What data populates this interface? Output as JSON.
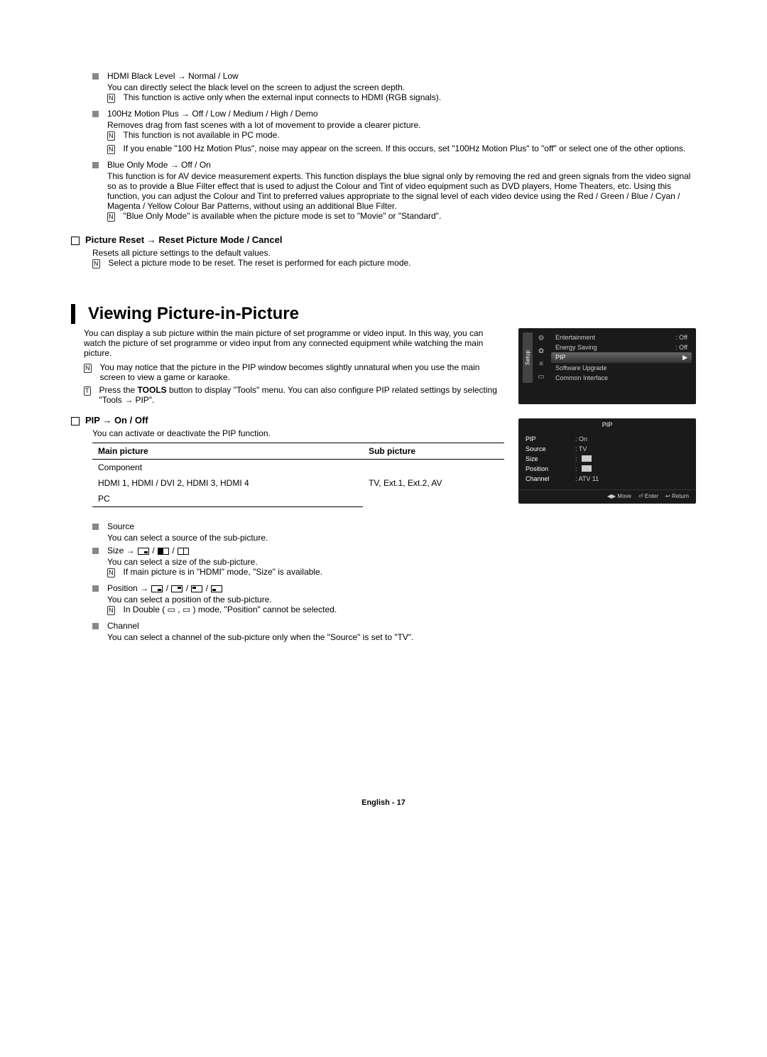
{
  "hdmi": {
    "title": "HDMI Black Level → Normal / Low",
    "desc": "You can directly select the black level on the screen to adjust the screen depth.",
    "note": "This function is active only when the external input connects to HDMI (RGB signals)."
  },
  "motion": {
    "title": "100Hz Motion Plus → Off / Low / Medium / High / Demo",
    "desc": "Removes drag from fast scenes with a lot of movement to provide a clearer picture.",
    "note1": "This function is not available in PC mode.",
    "note2": "If you enable \"100 Hz Motion Plus\", noise may appear on the screen. If this occurs, set \"100Hz Motion Plus\" to \"off\" or select one of the other options."
  },
  "blue": {
    "title": "Blue Only Mode → Off / On",
    "desc": "This function is for AV device measurement experts. This function displays the blue signal only by removing the red and green signals from the video signal so as to provide a Blue Filter effect that is used to adjust the Colour and Tint of video equipment such as DVD players, Home Theaters, etc. Using this function, you can adjust the Colour and Tint to preferred values appropriate to the signal level of each video device using the Red / Green / Blue / Cyan / Magenta / Yellow Colour Bar Patterns, without using an additional Blue Filter.",
    "note": "\"Blue Only Mode\" is available when the picture mode is set to \"Movie\" or \"Standard\"."
  },
  "reset": {
    "heading": "Picture Reset → Reset Picture Mode / Cancel",
    "desc": "Resets all picture settings to the default values.",
    "note": "Select a picture mode to be reset. The reset is performed for each picture mode."
  },
  "pip": {
    "heading": "Viewing Picture-in-Picture",
    "intro": "You can display a sub picture within the main picture of set programme or video input. In this way, you can watch the picture of set programme or video input from any connected equipment while watching the main picture.",
    "note_unnatural": "You may notice that the picture in the PIP window becomes slightly unnatural when you use the main screen to view a game or karaoke.",
    "tools_prefix": "Press the ",
    "tools_bold": "TOOLS",
    "tools_suffix": " button to display \"Tools\" menu. You can also configure PIP related settings by selecting \"Tools → PIP\".",
    "onoff_heading": "PIP → On / Off",
    "onoff_desc": "You can activate or deactivate the PIP function.",
    "table": {
      "h1": "Main picture",
      "h2": "Sub picture",
      "r1": "Component",
      "r2": "HDMI 1, HDMI / DVI 2, HDMI 3, HDMI 4",
      "r3": "PC",
      "sub": "TV, Ext.1, Ext.2, AV"
    },
    "source": {
      "title": "Source",
      "desc": "You can select a source of the sub-picture."
    },
    "size": {
      "title": "Size → ",
      "desc": "You can select a size of the sub-picture.",
      "note": "If main picture is in \"HDMI\" mode, \"Size\" is available."
    },
    "position": {
      "title": "Position → ",
      "desc": "You can select a position of the sub-picture.",
      "note": "In Double ( ▭ , ▭ ) mode, \"Position\" cannot be selected."
    },
    "channel": {
      "title": "Channel",
      "desc": "You can select a channel of the sub-picture only when the \"Source\" is set to \"TV\"."
    }
  },
  "osd1": {
    "tab": "Setup",
    "rows": [
      {
        "k": "Entertainment",
        "v": ": Off"
      },
      {
        "k": "Energy Saving",
        "v": ": Off"
      },
      {
        "k": "PIP",
        "v": ""
      },
      {
        "k": "Software Upgrade",
        "v": ""
      },
      {
        "k": "Common Interface",
        "v": ""
      }
    ]
  },
  "osd2": {
    "title": "PIP",
    "rows": {
      "pip": {
        "k": "PIP",
        "v": ": On"
      },
      "source": {
        "k": "Source",
        "v": ": TV"
      },
      "size": {
        "k": "Size",
        "v": ": "
      },
      "position": {
        "k": "Position",
        "v": ": "
      },
      "channel": {
        "k": "Channel",
        "v": ": ATV 11"
      }
    },
    "foot": {
      "move": "Move",
      "enter": "Enter",
      "return": "Return"
    }
  },
  "footer": "English - 17",
  "glyphs": {
    "note": "N",
    "tool": "T",
    "arrow": "▶",
    "move": "◀▶",
    "enter": "⏎",
    "return": "↩"
  }
}
